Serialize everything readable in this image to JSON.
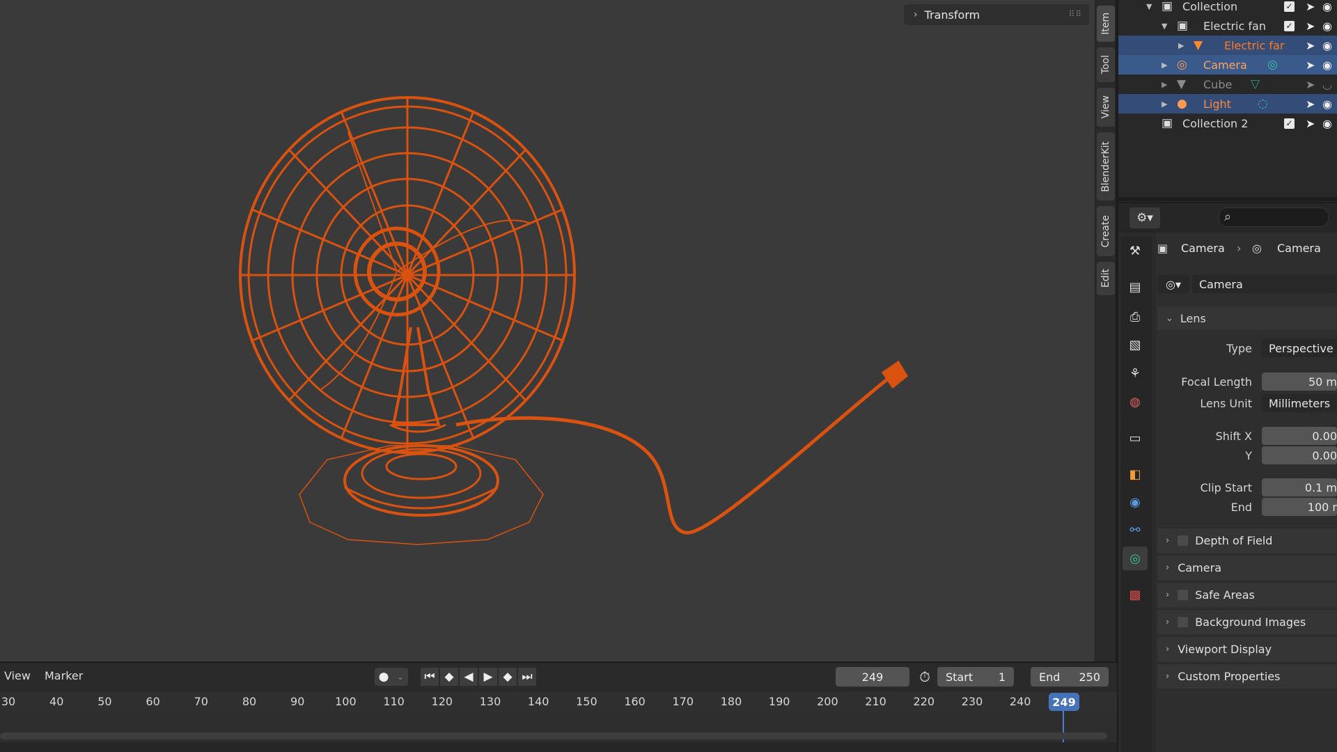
{
  "colors": {
    "accent_selected": "#ff7b1c",
    "wireframe": "#d9520f",
    "selection_row": "#334c78",
    "playhead": "#4573b9"
  },
  "viewport": {
    "transform_panel_label": "Transform"
  },
  "n_tabs": [
    "Item",
    "Tool",
    "View",
    "BlenderKit",
    "Create",
    "Edit"
  ],
  "outliner": {
    "rows": [
      {
        "label": "Collection",
        "icon": "collection-icon"
      },
      {
        "label": "Electric fan",
        "icon": "collection-icon"
      },
      {
        "label": "Electric far",
        "icon": "mesh-icon"
      },
      {
        "label": "Camera",
        "icon": "camera-icon"
      },
      {
        "label": "Cube",
        "icon": "mesh-icon"
      },
      {
        "label": "Light",
        "icon": "light-icon"
      },
      {
        "label": "Collection 2",
        "icon": "collection-icon"
      }
    ]
  },
  "properties": {
    "breadcrumb": {
      "object": "Camera",
      "data": "Camera"
    },
    "datablock_name": "Camera",
    "lens_panel": "Lens",
    "type_label": "Type",
    "type_value": "Perspective",
    "focal_length_label": "Focal Length",
    "focal_length_value": "50 m",
    "lens_unit_label": "Lens Unit",
    "lens_unit_value": "Millimeters",
    "shift_x_label": "Shift X",
    "shift_x_value": "0.00",
    "shift_y_label": "Y",
    "shift_y_value": "0.00",
    "clip_start_label": "Clip Start",
    "clip_start_value": "0.1 m",
    "clip_end_label": "End",
    "clip_end_value": "100 r",
    "panels": [
      "Depth of Field",
      "Camera",
      "Safe Areas",
      "Background Images",
      "Viewport Display",
      "Custom Properties"
    ]
  },
  "timeline": {
    "menu_view": "View",
    "menu_marker": "Marker",
    "current_frame": "249",
    "start_label": "Start",
    "start_value": "1",
    "end_label": "End",
    "end_value": "250",
    "ticks": [
      "30",
      "40",
      "50",
      "60",
      "70",
      "80",
      "90",
      "100",
      "110",
      "120",
      "130",
      "140",
      "150",
      "160",
      "170",
      "180",
      "190",
      "200",
      "210",
      "220",
      "230",
      "240"
    ],
    "playhead_label": "249"
  }
}
